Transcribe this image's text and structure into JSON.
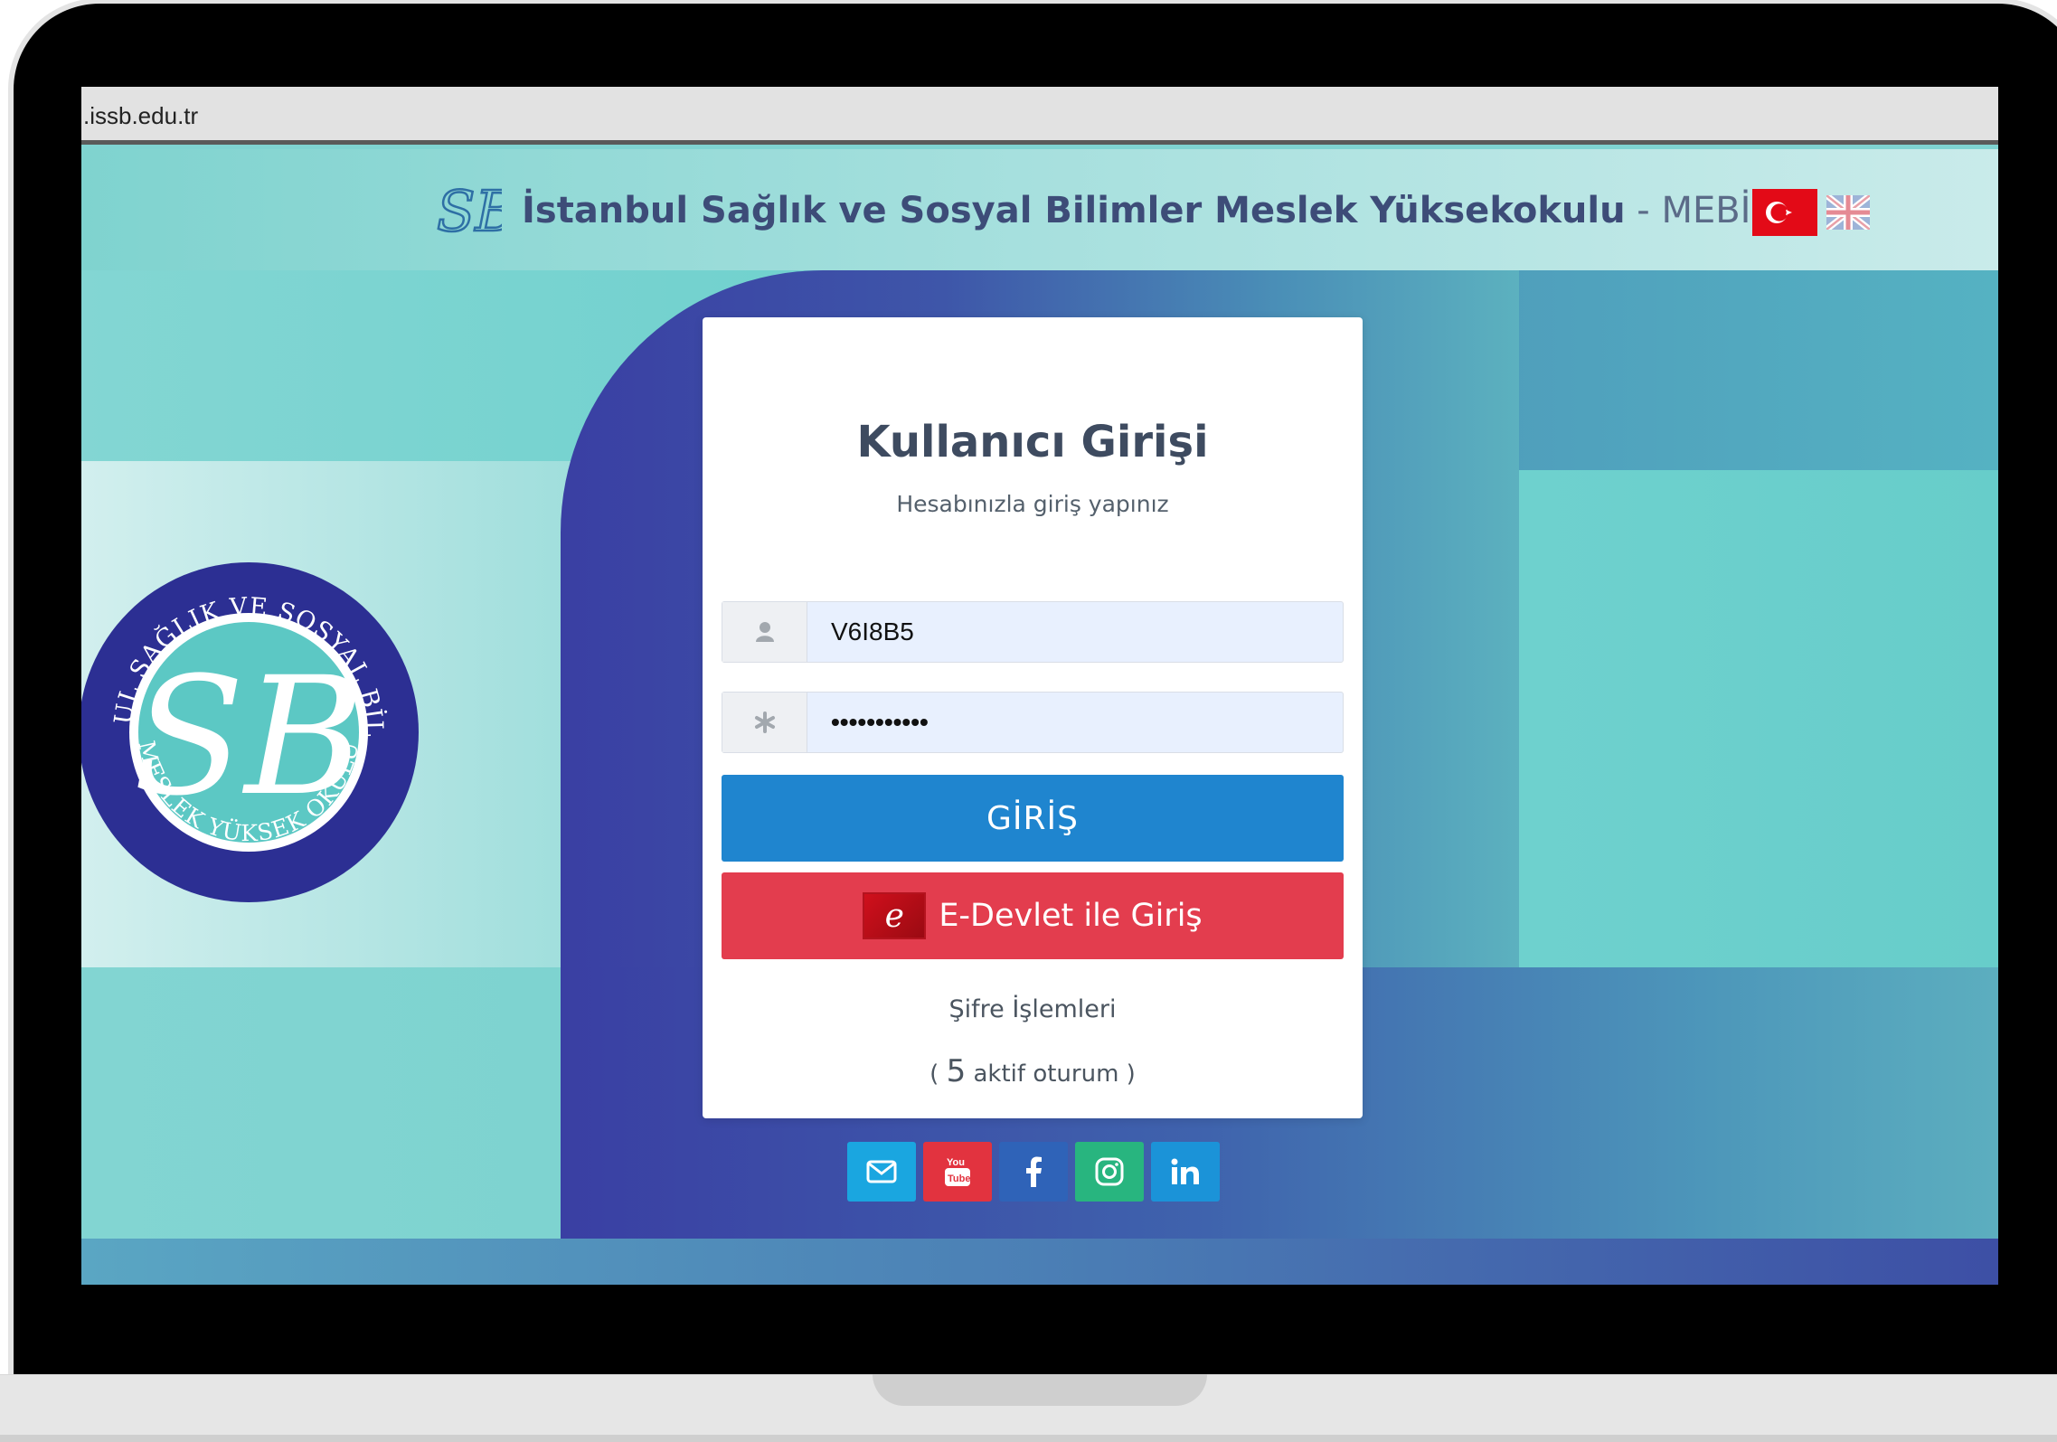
{
  "browser": {
    "address": ".issb.edu.tr"
  },
  "header": {
    "title": "İstanbul Sağlık ve Sosyal Bilimler Meslek Yüksekokulu",
    "suffix": " - MEBİS",
    "logo_text": "SB",
    "languages": [
      "turkish-flag",
      "uk-flag"
    ]
  },
  "seal": {
    "ring_top": "İSTANBUL SAĞLIK VE SOSYAL BİLİMLER",
    "ring_bottom": "MESLEK YÜKSEK OKULU",
    "monogram": "SB"
  },
  "login": {
    "title": "Kullanıcı Girişi",
    "subtitle": "Hesabınızla giriş yapınız",
    "username_value": "V6I8B5",
    "password_value": "•••••••••••",
    "login_button": "GİRİŞ",
    "edevlet_button": "E-Devlet ile Giriş",
    "edevlet_logo": "e",
    "password_link": "Şifre İşlemleri",
    "sessions_open": "( ",
    "sessions_count": "5",
    "sessions_label": " aktif oturum )"
  },
  "social": [
    {
      "name": "email-icon",
      "color": "#1aa6e0"
    },
    {
      "name": "youtube-icon",
      "color": "#e2333f"
    },
    {
      "name": "facebook-icon",
      "color": "#2f63b8"
    },
    {
      "name": "instagram-icon",
      "color": "#28b57f"
    },
    {
      "name": "linkedin-icon",
      "color": "#1b93d8"
    }
  ],
  "colors": {
    "login_button": "#1f85cf",
    "edevlet_button": "#e33d4e",
    "navy": "#3a3fa3",
    "teal": "#69cfcc"
  }
}
